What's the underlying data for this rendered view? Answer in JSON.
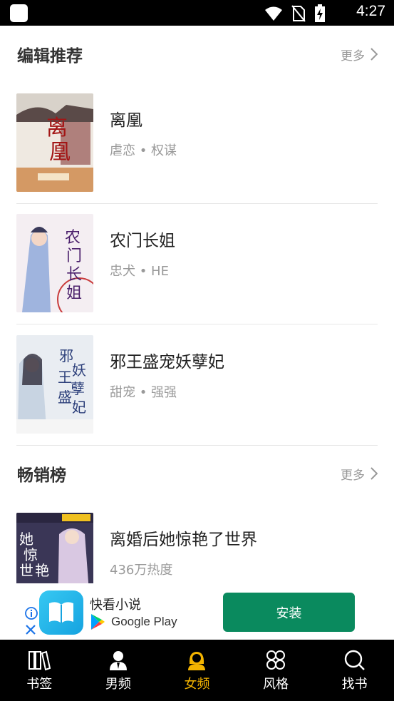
{
  "status_bar": {
    "time": "4:27"
  },
  "sections": {
    "editor": {
      "title": "编辑推荐",
      "more": "更多"
    },
    "bestseller": {
      "title": "畅销榜",
      "more": "更多"
    }
  },
  "books": [
    {
      "title": "离凰",
      "tags": "虐恋 • 权谋"
    },
    {
      "title": "农门长姐",
      "tags": "忠犬 • HE"
    },
    {
      "title": "邪王盛宠妖孽妃",
      "tags": "甜宠 • 强强"
    },
    {
      "title": "离婚后她惊艳了世界",
      "tags": "436万热度"
    }
  ],
  "ad": {
    "app_name": "快看小说",
    "store": "Google Play",
    "install_label": "安装"
  },
  "tabs": [
    {
      "label": "书签",
      "icon": "bookshelf-icon"
    },
    {
      "label": "男频",
      "icon": "male-person-icon"
    },
    {
      "label": "女频",
      "icon": "female-person-icon",
      "active": true
    },
    {
      "label": "风格",
      "icon": "grid-flower-icon"
    },
    {
      "label": "找书",
      "icon": "search-icon"
    }
  ],
  "colors": {
    "active_tab": "#f4b400",
    "install_button": "#0a8a5e"
  }
}
